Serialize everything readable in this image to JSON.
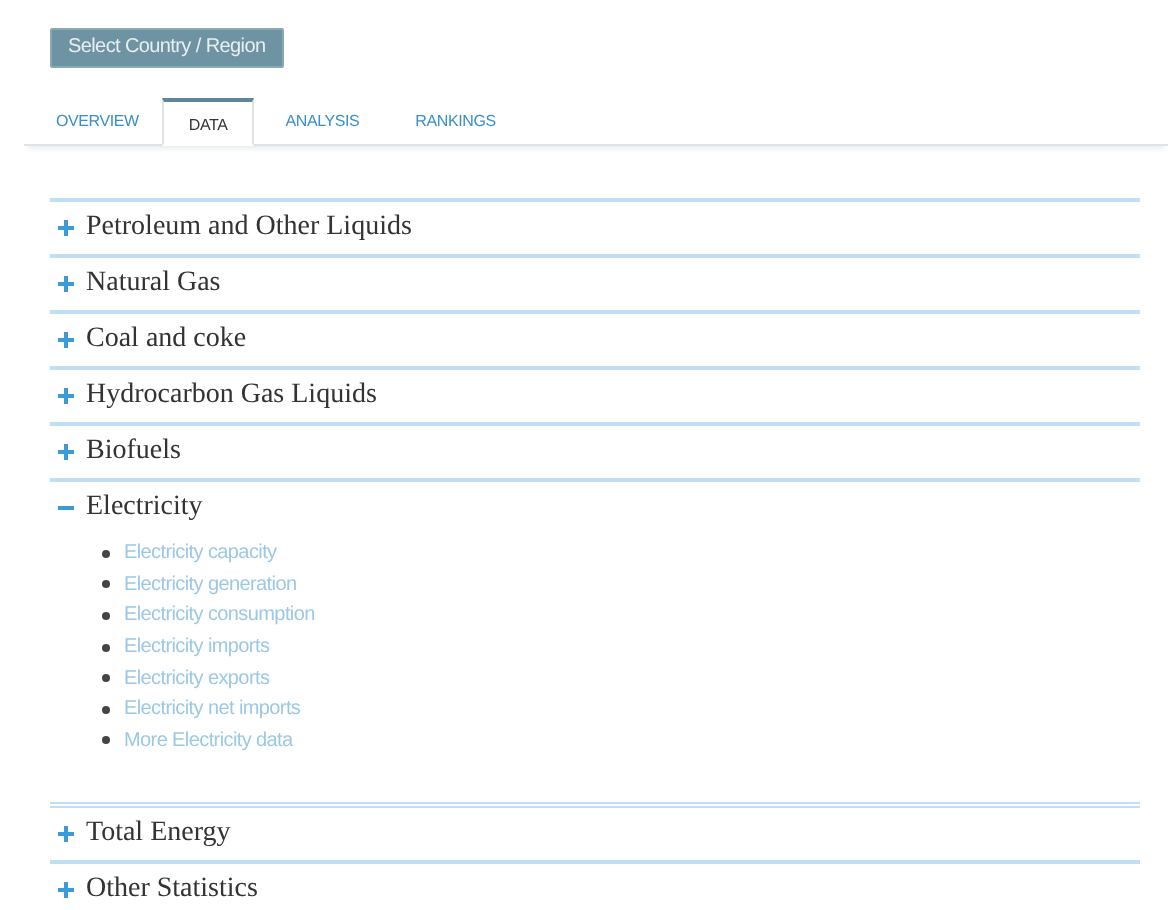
{
  "region_button": "Select Country / Region",
  "tabs": [
    {
      "label": "OVERVIEW",
      "selected": false
    },
    {
      "label": "DATA",
      "selected": true
    },
    {
      "label": "ANALYSIS",
      "selected": false
    },
    {
      "label": "RANKINGS",
      "selected": false
    }
  ],
  "sections": [
    {
      "title": "Petroleum and Other Liquids",
      "expanded": false
    },
    {
      "title": "Natural Gas",
      "expanded": false
    },
    {
      "title": "Coal and coke",
      "expanded": false
    },
    {
      "title": "Hydrocarbon Gas Liquids",
      "expanded": false
    },
    {
      "title": "Biofuels",
      "expanded": false
    },
    {
      "title": "Electricity",
      "expanded": true,
      "links": [
        "Electricity capacity",
        "Electricity generation",
        "Electricity consumption",
        "Electricity imports",
        "Electricity exports",
        "Electricity net imports",
        "More Electricity data"
      ]
    },
    {
      "title": "Total Energy",
      "expanded": false
    },
    {
      "title": "Other Statistics",
      "expanded": false
    }
  ]
}
